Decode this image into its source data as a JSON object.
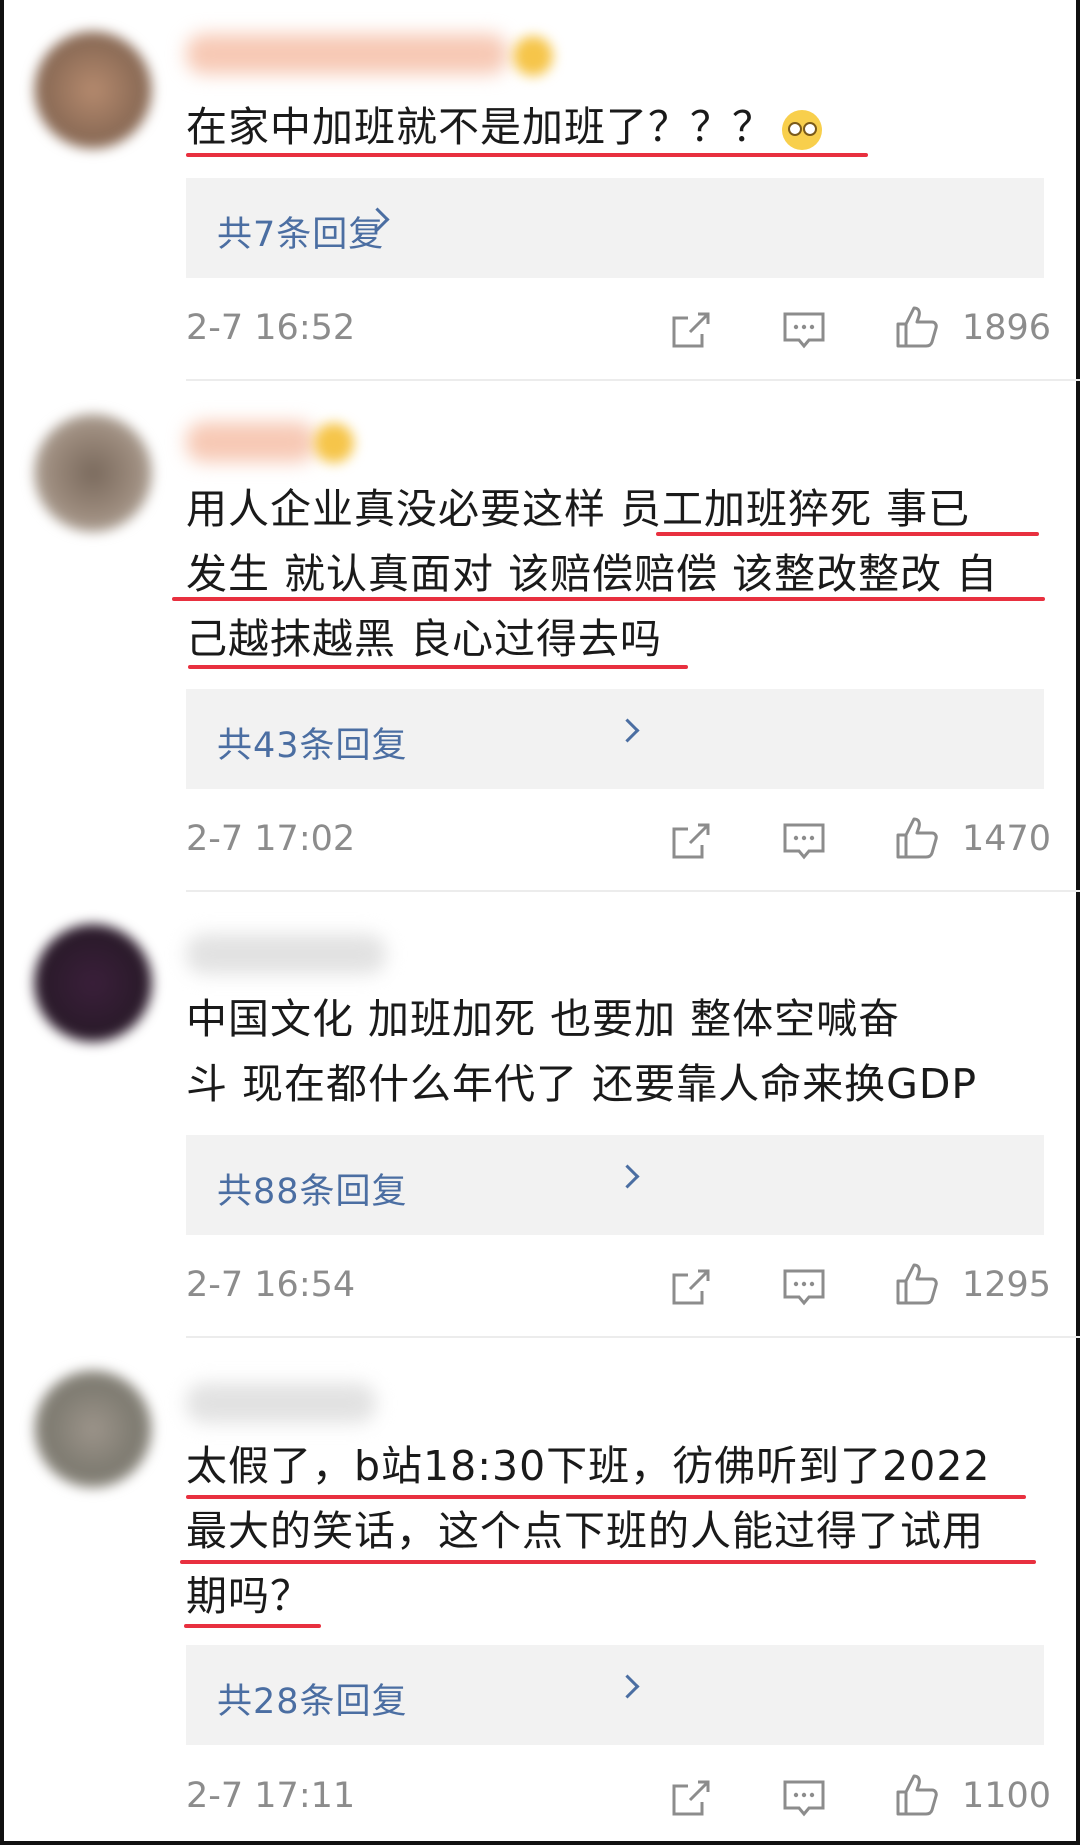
{
  "comments": [
    {
      "lines": [
        "在家中加班就不是加班了？？？"
      ],
      "emoji": "eye-roll-emoji",
      "replies": "共7条回复",
      "time": "2-7 16:52",
      "likes": "1896"
    },
    {
      "lines": [
        "用人企业真没必要这样  员工加班猝死  事已",
        "发生 就认真面对 该赔偿赔偿 该整改整改 自",
        "己越抹越黑 良心过得去吗"
      ],
      "replies": "共43条回复",
      "time": "2-7 17:02",
      "likes": "1470"
    },
    {
      "lines": [
        "中国文化    加班加死 也要加    整体空喊奋",
        "斗  现在都什么年代了 还要靠人命来换GDP"
      ],
      "replies": "共88条回复",
      "time": "2-7 16:54",
      "likes": "1295"
    },
    {
      "lines": [
        "太假了，b站18:30下班，彷佛听到了2022",
        "最大的笑话，这个点下班的人能过得了试用",
        "期吗？"
      ],
      "replies": "共28条回复",
      "time": "2-7 17:11",
      "likes": "1100"
    }
  ],
  "colors": {
    "link": "#4b6ea2",
    "underline": "#e8303f",
    "meta": "#8c8c8c"
  },
  "icons": [
    "share-icon",
    "comment-icon",
    "like-icon",
    "chevron-right-icon"
  ]
}
